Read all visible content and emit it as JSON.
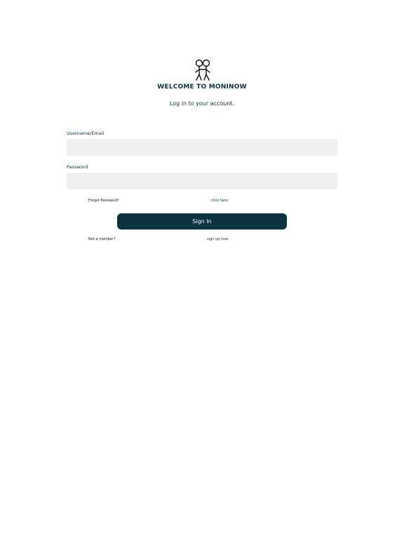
{
  "header": {
    "logo_icon": "two-stick-figures-icon",
    "welcome_title": "WELCOME TO MONINOW",
    "subtitle": "Log in to your account."
  },
  "form": {
    "username_label": "Username/Email",
    "username_value": "",
    "username_placeholder": "",
    "password_label": "Password",
    "password_value": "",
    "password_placeholder": ""
  },
  "forgot": {
    "prompt": "Forgot Password?",
    "link": "click here"
  },
  "actions": {
    "sign_in_label": "Sign In"
  },
  "signup": {
    "prompt": "Not a member?",
    "link": "sign up now"
  },
  "colors": {
    "primary": "#0c3340",
    "input_background": "#eef0f1",
    "background": "#ffffff"
  }
}
